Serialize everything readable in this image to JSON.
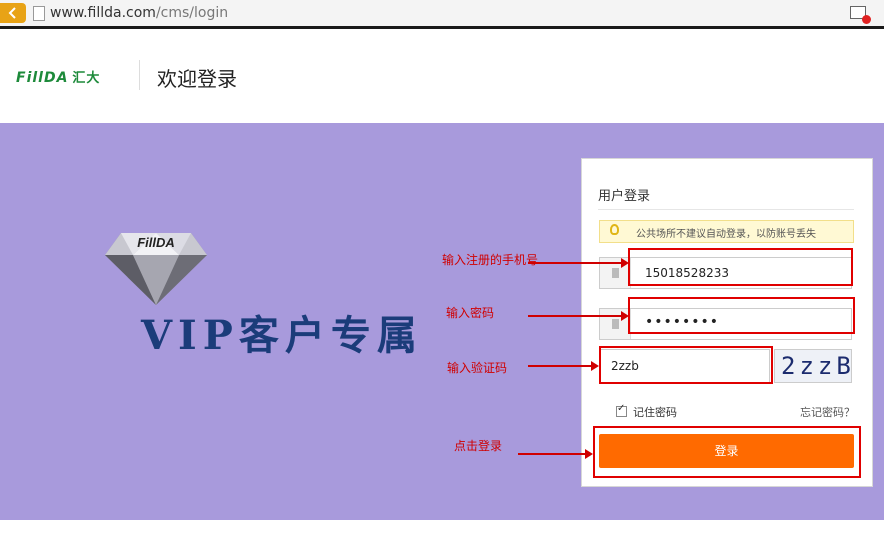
{
  "browser": {
    "url_host": "www.fillda.com",
    "url_path": "/cms/login"
  },
  "header": {
    "logo_latin": "FillDA",
    "logo_cn": "汇大",
    "title": "欢迎登录"
  },
  "hero": {
    "diamond_text": "FillDA",
    "vip_text": "VIP客户专属"
  },
  "login": {
    "title": "用户登录",
    "tip": "公共场所不建议自动登录，以防账号丢失",
    "phone_value": "15018528233",
    "password_value": "••••••••",
    "captcha_value": "2zzb",
    "captcha_image_text": "2zzB",
    "remember_label": "记住密码",
    "forgot_label": "忘记密码？",
    "submit_label": "登录"
  },
  "annotations": {
    "phone": "输入注册的手机号",
    "password": "输入密码",
    "captcha": "输入验证码",
    "submit": "点击登录"
  },
  "colors": {
    "purple_bg": "#a89adc",
    "orange_button": "#ff6a00",
    "annotation_red": "#e00000",
    "logo_green": "#1d8a3a"
  }
}
